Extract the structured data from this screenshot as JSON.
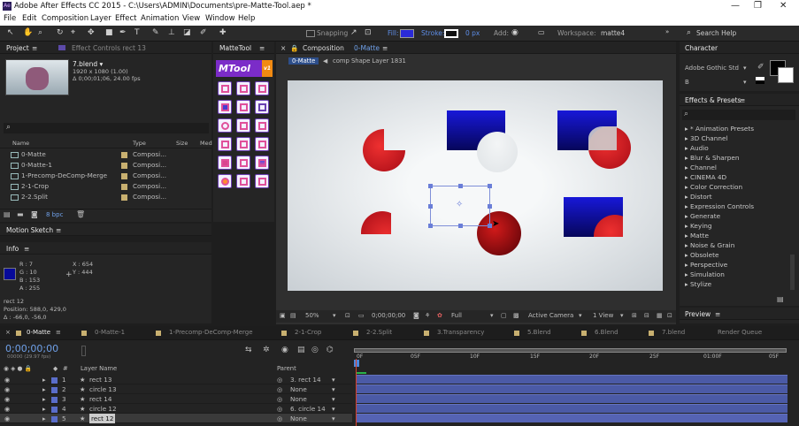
{
  "app": {
    "title": "Adobe After Effects CC 2015 - C:\\Users\\ADMIN\\Documents\\pre-Matte-Tool.aep *",
    "icon": "ae-app-icon"
  },
  "window_controls": {
    "minimize": "—",
    "restore": "❐",
    "close": "✕"
  },
  "menu": [
    "File",
    "Edit",
    "Composition",
    "Layer",
    "Effect",
    "Animation",
    "View",
    "Window",
    "Help"
  ],
  "toolbar": {
    "snapping": "Snapping",
    "fill": "Fill:",
    "stroke": "Stroke:",
    "stroke_px": "0 px",
    "add": "Add:",
    "workspace_label": "Workspace:",
    "workspace": "matte4",
    "search": "Search Help",
    "fill_color": "#2a2ad8"
  },
  "project": {
    "tab": "Project",
    "effect_controls": "Effect Controls rect 13",
    "item_name": "7.blend ▾",
    "item_dims": "1920 x 1080 (1.00)",
    "item_dur": "Δ 0;00;01;06, 24.00 fps",
    "search_icon": "⌕",
    "columns": {
      "name": "Name",
      "type": "Type",
      "size": "Size",
      "med": "Med"
    },
    "rows": [
      {
        "name": "0-Matte",
        "type": "Composi..."
      },
      {
        "name": "0-Matte-1",
        "type": "Composi..."
      },
      {
        "name": "1-Precomp-DeComp-Merge",
        "type": "Composi..."
      },
      {
        "name": "2-1-Crop",
        "type": "Composi..."
      },
      {
        "name": "2-2.Split",
        "type": "Composi..."
      }
    ],
    "bpc": "8 bpc"
  },
  "matte_tool": {
    "tab": "MatteTool",
    "logo": "MTool",
    "logo_suffix": "v1"
  },
  "motion_sketch": {
    "tab": "Motion Sketch"
  },
  "info": {
    "tab": "Info",
    "r": "R : 7",
    "g": "G : 10",
    "b": "B : 153",
    "a": "A : 255",
    "x": "X : 654",
    "y": "Y : 444",
    "layer": "rect 12",
    "position": "Position: 588,0, 429,0",
    "delta": "Δ : -66,0, -56,0",
    "swatch": "#070a99"
  },
  "composition": {
    "tab": "Composition",
    "tab_name": "0-Matte",
    "breadcrumb_active": "0-Matte",
    "breadcrumb_next": "comp Shape Layer 1831",
    "zoom": "50%",
    "timecode": "0;00;00;00",
    "resolution": "Full",
    "camera": "Active Camera",
    "view": "1 View"
  },
  "character": {
    "tab": "Character",
    "font": "Adobe Gothic Std",
    "style": "B"
  },
  "effects": {
    "tab": "Effects & Presets",
    "items": [
      "* Animation Presets",
      "3D Channel",
      "Audio",
      "Blur & Sharpen",
      "Channel",
      "CINEMA 4D",
      "Color Correction",
      "Distort",
      "Expression Controls",
      "Generate",
      "Keying",
      "Matte",
      "Noise & Grain",
      "Obsolete",
      "Perspective",
      "Simulation",
      "Stylize"
    ]
  },
  "preview": {
    "tab": "Preview"
  },
  "timeline": {
    "tabs": [
      "0-Matte",
      "0-Matte-1",
      "1-Precomp-DeComp-Merge",
      "2-1-Crop",
      "2-2.Split",
      "3.Transparency",
      "5.Blend",
      "6.Blend",
      "7.blend",
      "Render Queue"
    ],
    "timecode": "0;00;00;00",
    "fps": "00000 (29.97 fps)",
    "col_layer": "Layer Name",
    "col_parent": "Parent",
    "col_hash": "#",
    "ruler": [
      "0F",
      "05F",
      "10F",
      "15F",
      "20F",
      "25F",
      "01:00F",
      "05F"
    ],
    "layers": [
      {
        "num": "1",
        "name": "rect 13",
        "parent": "3. rect 14"
      },
      {
        "num": "2",
        "name": "circle 13",
        "parent": "None"
      },
      {
        "num": "3",
        "name": "rect 14",
        "parent": "None"
      },
      {
        "num": "4",
        "name": "circle 12",
        "parent": "6. circle 14"
      },
      {
        "num": "5",
        "name": "rect 12",
        "parent": "None"
      }
    ]
  }
}
